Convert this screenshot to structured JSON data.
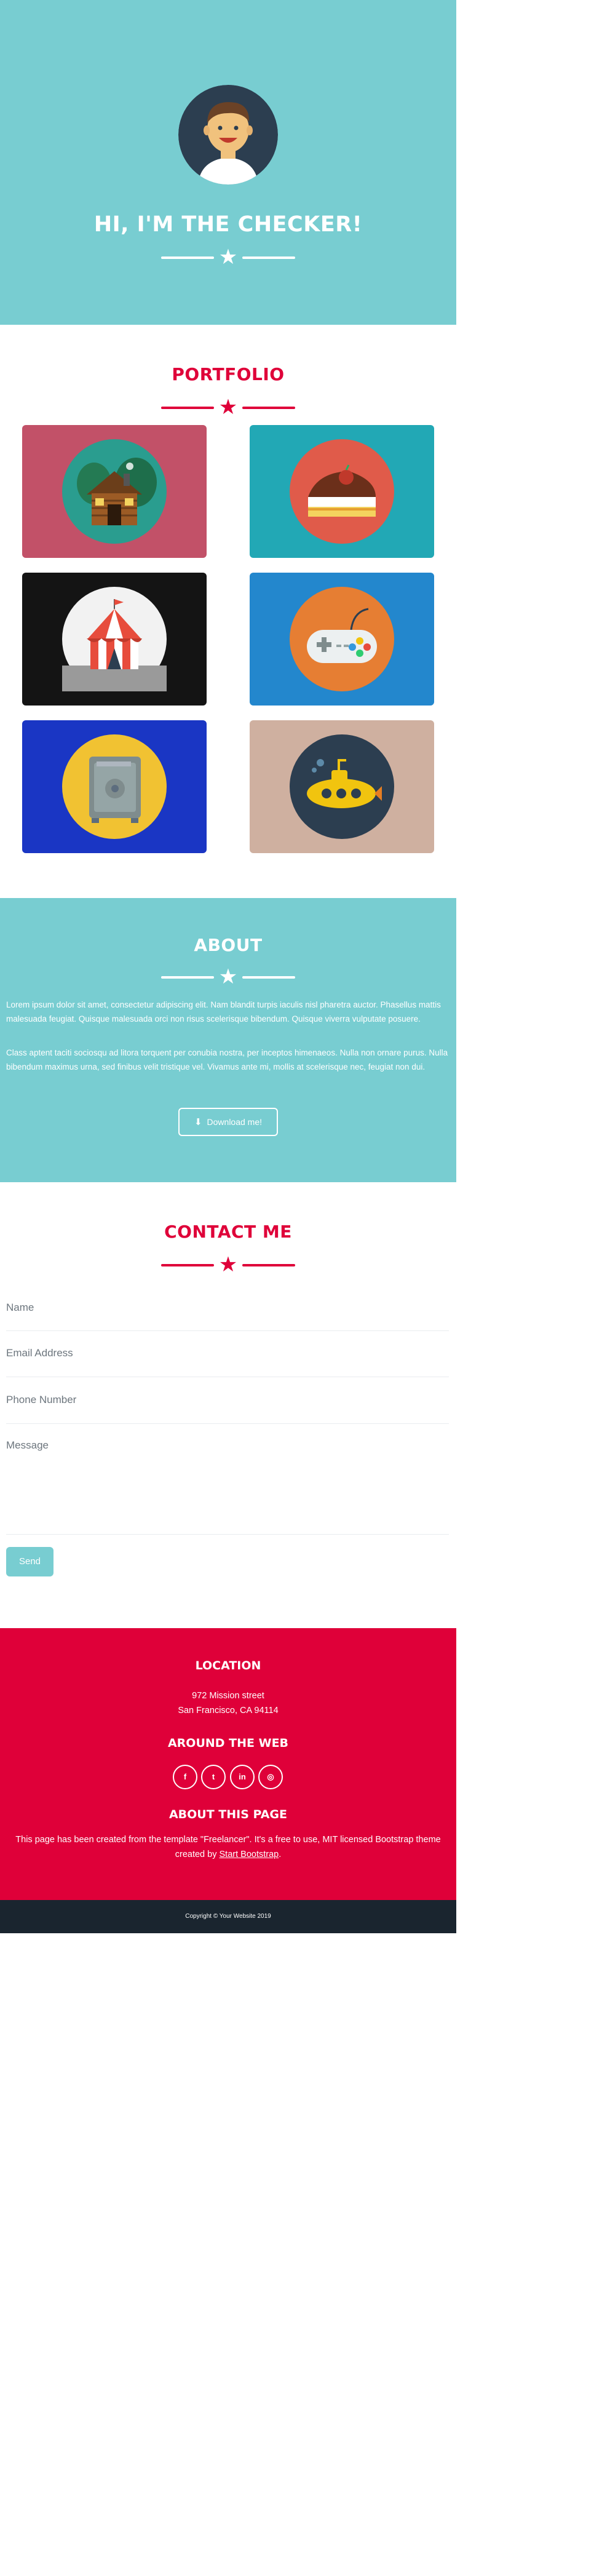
{
  "colors": {
    "hero_bg": "#78cdd1",
    "accent": "#df0039",
    "dark": "#1a252f"
  },
  "hero": {
    "avatar_icon": "avatar-icon",
    "title": "HI, I'M THE CHECKER!"
  },
  "portfolio": {
    "title": "PORTFOLIO",
    "items": [
      {
        "icon": "cabin-icon",
        "bg": "#c25168"
      },
      {
        "icon": "cake-icon",
        "bg": "#22a8b5"
      },
      {
        "icon": "circus-tent-icon",
        "bg": "#141414"
      },
      {
        "icon": "game-controller-icon",
        "bg": "#2387cd"
      },
      {
        "icon": "safe-icon",
        "bg": "#1a36c4"
      },
      {
        "icon": "submarine-icon",
        "bg": "#cfb0a0"
      }
    ]
  },
  "about": {
    "title": "ABOUT",
    "paragraph_1": "Lorem ipsum dolor sit amet, consectetur adipiscing elit. Nam blandit turpis iaculis nisl pharetra auctor. Phasellus mattis malesuada feugiat. Quisque malesuada orci non risus scelerisque bibendum. Quisque viverra vulputate posuere.",
    "paragraph_2": "Class aptent taciti sociosqu ad litora torquent per conubia nostra, per inceptos himenaeos. Nulla non ornare purus. Nulla bibendum maximus urna, sed finibus velit tristique vel. Vivamus ante mi, mollis at scelerisque nec, feugiat non dui.",
    "download_label": "Download me!",
    "download_icon": "download-icon"
  },
  "contact": {
    "title": "CONTACT ME",
    "name_placeholder": "Name",
    "email_placeholder": "Email Address",
    "phone_placeholder": "Phone Number",
    "message_placeholder": "Message",
    "send_label": "Send"
  },
  "footer": {
    "location_title": "LOCATION",
    "address_line_1": "972 Mission street",
    "address_line_2": "San Francisco, CA 94114",
    "web_title": "AROUND THE WEB",
    "social": [
      {
        "icon": "facebook-icon",
        "glyph": "f"
      },
      {
        "icon": "twitter-icon",
        "glyph": "t"
      },
      {
        "icon": "linkedin-icon",
        "glyph": "in"
      },
      {
        "icon": "dribbble-icon",
        "glyph": "◎"
      }
    ],
    "about_title": "ABOUT THIS PAGE",
    "about_text_1": "This page has been created from the template \"Freelancer\". It's a free to use, MIT licensed Bootstrap theme",
    "about_text_2_prefix": "created by ",
    "about_link": "Start Bootstrap",
    "about_text_2_suffix": "."
  },
  "copyright": "Copyright © Your Website 2019"
}
